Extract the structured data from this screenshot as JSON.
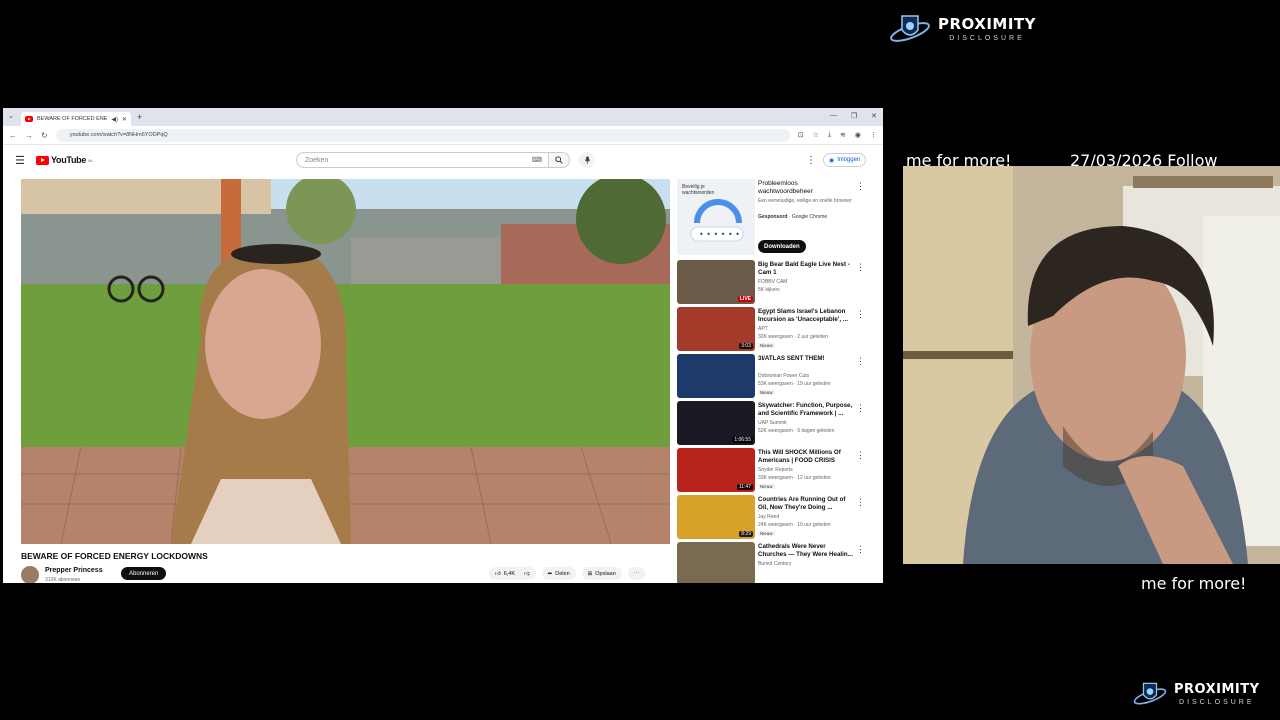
{
  "overlay": {
    "brand_name": "PROXIMITY",
    "brand_sub": "DISCLOSURE",
    "ticker_left": "me for more!",
    "ticker_right": "27/03/2026 Follow",
    "ticker_bottom": "me for more!"
  },
  "browser": {
    "tab_title": "BEWARE OF FORCED ENER",
    "url": "youtube.com/watch?v=8NHm6YODPqQ"
  },
  "youtube": {
    "logo_text": "YouTube",
    "logo_region": "NL",
    "search_placeholder": "Zoeken",
    "signin_label": "Inloggen",
    "video": {
      "title": "BEWARE OF FORCED ENERGY LOCKDOWNS",
      "channel": "Prepper Princess",
      "subscribers": "312K abonnees",
      "subscribe_label": "Abonneren",
      "likes": "6,4K",
      "share_label": "Delen",
      "save_label": "Opslaan"
    },
    "ad": {
      "thumb_text": "Beveilig je wachtwoorden",
      "title": "Probleemloos wachtwoordbeheer",
      "desc": "Een eenvoudige, veilige en snelle browser",
      "sponsored": "Gesponsord",
      "sponsor": "· Google Chrome",
      "button": "Downloaden"
    },
    "recommendations": [
      {
        "title": "Big Bear Bald Eagle Live Nest - Cam 1",
        "channel": "FOBBV CAM",
        "meta": "5K kijkers",
        "badge": "",
        "duration": "",
        "live": "LIVE",
        "thumb_color": "#6b5a48"
      },
      {
        "title": "Egypt Slams Israel's Lebanon Incursion as 'Unacceptable', ...",
        "channel": "APT",
        "meta": "32K weergaven · 2 uur geleden",
        "badge": "Nieuw",
        "duration": "3:03",
        "live": "",
        "thumb_color": "#a33a2a"
      },
      {
        "title": "3I/ATLAS SENT THEM!",
        "channel": "Dobsonian Power Cuts",
        "meta": "53K weergaven · 19 uur geleden",
        "badge": "Nieuw",
        "duration": "",
        "live": "",
        "thumb_color": "#1d3b6a"
      },
      {
        "title": "Skywatcher: Function, Purpose, and Scientific Framework | ...",
        "channel": "UAP Summit",
        "meta": "52K weergaven · 9 dagen geleden",
        "badge": "",
        "duration": "1:06:55",
        "live": "",
        "thumb_color": "#1a1a24"
      },
      {
        "title": "This Will SHOCK Millions Of Americans | FOOD CRISIS",
        "channel": "Snyder Reports",
        "meta": "33K weergaven · 12 uur geleden",
        "badge": "Nieuw",
        "duration": "11:47",
        "live": "",
        "thumb_color": "#b8231c"
      },
      {
        "title": "Countries Are Running Out of Oil, Now They're Doing ...",
        "channel": "Jay Reed",
        "meta": "24K weergaven · 10 uur geleden",
        "badge": "Nieuw",
        "duration": "8:29",
        "live": "",
        "thumb_color": "#d8a12a"
      },
      {
        "title": "Cathedrals Were Never Churches — They Were Healin...",
        "channel": "Buried Century",
        "meta": "",
        "badge": "",
        "duration": "",
        "live": "",
        "thumb_color": "#7a6a52"
      }
    ]
  }
}
